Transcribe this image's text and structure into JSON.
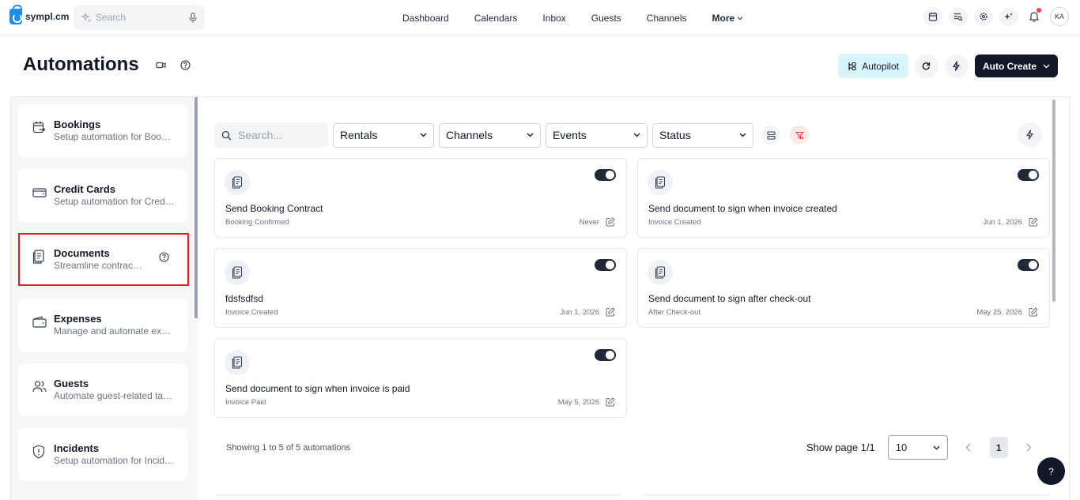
{
  "brand": {
    "name": "sympl",
    "dot": ".",
    "suffix": "cm"
  },
  "topbar": {
    "search_placeholder": "Search",
    "nav": [
      "Dashboard",
      "Calendars",
      "Inbox",
      "Guests",
      "Channels"
    ],
    "more_label": "More",
    "avatar_initials": "KA"
  },
  "header": {
    "title": "Automations",
    "autopilot_label": "Autopilot",
    "auto_create_label": "Auto Create"
  },
  "sidebar": {
    "items": [
      {
        "title": "Bookings",
        "desc": "Setup automation for Bookings"
      },
      {
        "title": "Credit Cards",
        "desc": "Setup automation for Credit Cards"
      },
      {
        "title": "Documents",
        "desc": "Streamline contracts and documents"
      },
      {
        "title": "Expenses",
        "desc": "Manage and automate expenses"
      },
      {
        "title": "Guests",
        "desc": "Automate guest-related tasks"
      },
      {
        "title": "Incidents",
        "desc": "Setup automation for Incidents"
      }
    ]
  },
  "filters": {
    "search_placeholder": "Search...",
    "selects": [
      "Rentals",
      "Channels",
      "Events",
      "Status"
    ]
  },
  "cards": [
    {
      "title": "Send Booking Contract",
      "trigger": "Booking Confirmed",
      "date": "Never",
      "enabled": true
    },
    {
      "title": "Send document to sign when invoice created",
      "trigger": "Invoice Created",
      "date": "Jun 1, 2026",
      "enabled": true
    },
    {
      "title": "fdsfsdfsd",
      "trigger": "Invoice Created",
      "date": "Jun 1, 2026",
      "enabled": true
    },
    {
      "title": "Send document to sign after check-out",
      "trigger": "After Check-out",
      "date": "May 25, 2026",
      "enabled": true
    },
    {
      "title": "Send document to sign when invoice is paid",
      "trigger": "Invoice Paid",
      "date": "May 5, 2026",
      "enabled": true
    }
  ],
  "pagination": {
    "showing": "Showing 1 to 5 of 5 automations",
    "show_page": "Show page 1/1",
    "per_page": "10",
    "current_page": "1"
  },
  "help_fab": "?",
  "colors": {
    "accent": "#1e8fe6",
    "highlight": "#e11d1d",
    "autopilot_bg": "#d7f5fb",
    "dark": "#111827"
  }
}
